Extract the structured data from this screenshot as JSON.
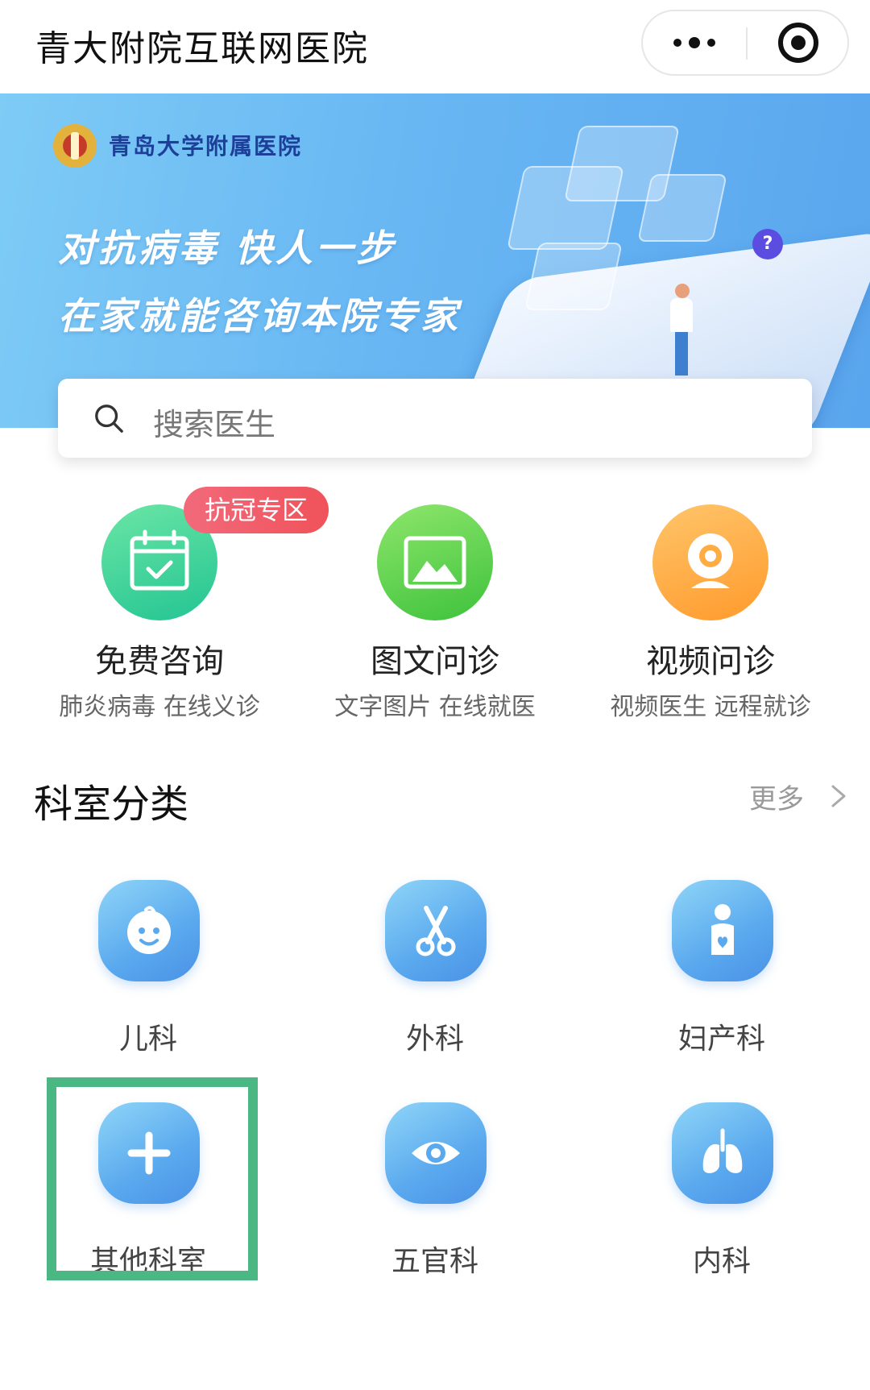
{
  "header": {
    "title": "青大附院互联网医院",
    "more_icon": "more-dots-icon",
    "close_icon": "target-close-icon"
  },
  "banner": {
    "hospital_name": "青岛大学附属医院",
    "slogan_line1": "对抗病毒 快人一步",
    "slogan_line2": "在家就能咨询本院专家"
  },
  "search": {
    "placeholder": "搜索医生"
  },
  "services": [
    {
      "name": "免费咨询",
      "subtitle": "肺炎病毒 在线义诊",
      "icon": "calendar-check-icon",
      "badge": "抗冠专区"
    },
    {
      "name": "图文问诊",
      "subtitle": "文字图片 在线就医",
      "icon": "image-icon"
    },
    {
      "name": "视频问诊",
      "subtitle": "视频医生 远程就诊",
      "icon": "webcam-icon"
    }
  ],
  "departments_section": {
    "title": "科室分类",
    "more_label": "更多"
  },
  "departments": [
    {
      "label": "儿科",
      "icon": "baby-face-icon"
    },
    {
      "label": "外科",
      "icon": "scissors-icon"
    },
    {
      "label": "妇产科",
      "icon": "mother-heart-icon"
    },
    {
      "label": "其他科室",
      "icon": "plus-icon",
      "highlighted": true
    },
    {
      "label": "五官科",
      "icon": "eye-icon"
    },
    {
      "label": "内科",
      "icon": "lungs-icon"
    }
  ],
  "colors": {
    "banner": "#68b7f3",
    "department_tile": "#5aa9ee",
    "highlight_border": "#4bb783",
    "badge": "#f0525a"
  }
}
